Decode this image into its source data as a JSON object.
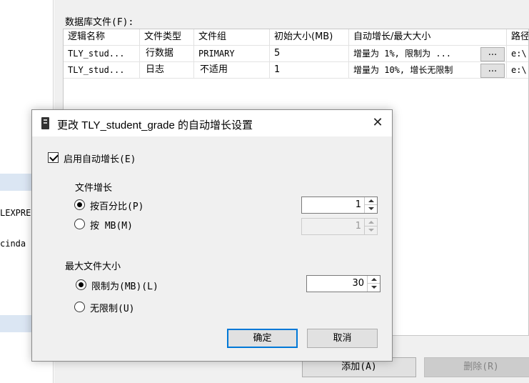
{
  "left_panel": {
    "text_1": "LEXPRE",
    "text_2": "cinda"
  },
  "files_section": {
    "label": "数据库文件(F):",
    "columns": [
      "逻辑名称",
      "文件类型",
      "文件组",
      "初始大小(MB)",
      "自动增长/最大大小",
      "路径"
    ],
    "rows": [
      {
        "logical_name": "TLY_stud...",
        "file_type": "行数据",
        "filegroup": "PRIMARY",
        "initial_size": "5",
        "autogrowth": "增量为 1%, 限制为 ...",
        "path": "e:\\"
      },
      {
        "logical_name": "TLY_stud...",
        "file_type": "日志",
        "filegroup": "不适用",
        "initial_size": "1",
        "autogrowth": "增量为 10%, 增长无限制",
        "path": "e:\\"
      }
    ],
    "ellipsis_label": "..."
  },
  "buttons": {
    "add": "添加(A)",
    "remove": "删除(R)"
  },
  "dialog": {
    "title": "更改 TLY_student_grade 的自动增长设置",
    "enable_autogrowth": {
      "label": "启用自动增长(E)",
      "checked": true
    },
    "file_growth": {
      "heading": "文件增长",
      "percent_option": {
        "label": "按百分比(P)",
        "selected": true,
        "value": "1"
      },
      "mb_option": {
        "label": "按 MB(M)",
        "selected": false,
        "value": "1"
      }
    },
    "max_file_size": {
      "heading": "最大文件大小",
      "limited_option": {
        "label": "限制为(MB)(L)",
        "selected": true,
        "value": "30"
      },
      "unlimited_option": {
        "label": "无限制(U)",
        "selected": false
      }
    },
    "ok_label": "确定",
    "cancel_label": "取消"
  },
  "colors": {
    "selection_highlight": "#dbe6f3",
    "primary_button_border": "#0078d7",
    "window_background": "#f0f0f0"
  }
}
